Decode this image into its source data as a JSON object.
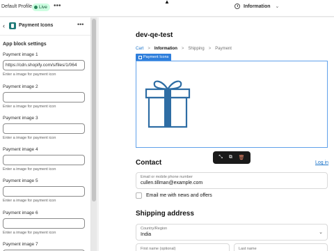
{
  "topbar": {
    "profile_label": "Default Profile",
    "status_badge": "Live",
    "more_label": "•••",
    "page_selector": "Information",
    "chevron": "⌄"
  },
  "sidebar": {
    "back_label": "‹",
    "title": "Payment Icons",
    "more_label": "•••",
    "section_title": "App block settings",
    "fields": [
      {
        "label": "Payment image 1",
        "value": "https://cdn.shopify.com/s/files/1/064",
        "help": "Enter a image for payment icon"
      },
      {
        "label": "Payment image 2",
        "value": "",
        "help": "Enter a image for payment icon"
      },
      {
        "label": "Payment image 3",
        "value": "",
        "help": "Enter a image for payment icon"
      },
      {
        "label": "Payment image 4",
        "value": "",
        "help": "Enter a image for payment icon"
      },
      {
        "label": "Payment image 5",
        "value": "",
        "help": "Enter a image for payment icon"
      },
      {
        "label": "Payment image 6",
        "value": "",
        "help": "Enter a image for payment icon"
      },
      {
        "label": "Payment image 7",
        "value": "",
        "help": ""
      }
    ]
  },
  "preview": {
    "store_name": "dev-qe-test",
    "breadcrumb": {
      "cart": "Cart",
      "information": "Information",
      "shipping": "Shipping",
      "payment": "Payment",
      "separator": ">"
    },
    "block_tag": "Payment Icons",
    "contact": {
      "heading": "Contact",
      "login_link": "Log in",
      "email_label": "Email or mobile phone number",
      "email_value": "cullen.tillman@example.com",
      "newsletter_label": "Email me with news and offers"
    },
    "shipping": {
      "heading": "Shipping address",
      "country_label": "Country/Region",
      "country_value": "India",
      "first_name_label": "First name (optional)",
      "last_name_label": "Last name"
    }
  },
  "colors": {
    "accent_blue": "#2f7fdc",
    "gift_blue": "#2e6da4",
    "live_green": "#cdfee1",
    "toolbar_bg": "#1a1a1a"
  }
}
